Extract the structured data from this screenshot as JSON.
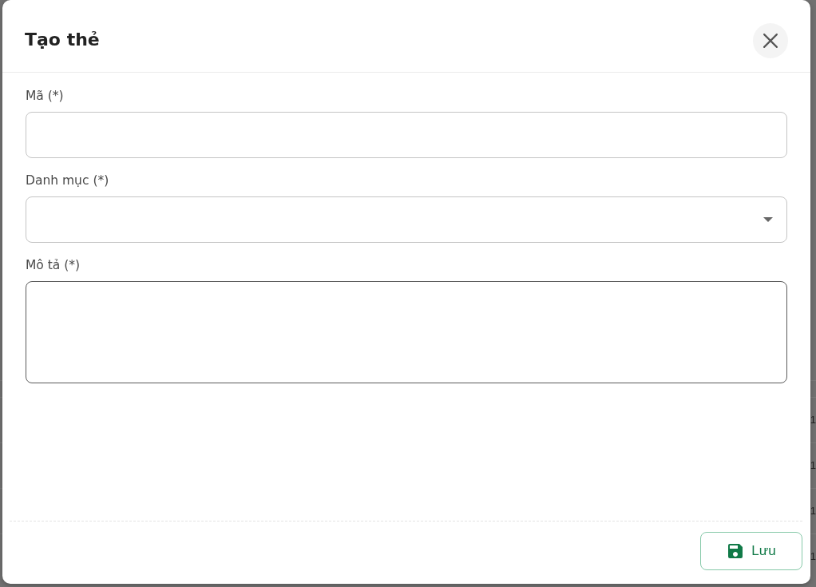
{
  "backdrop": {
    "rows": [
      {
        "column_1": "1"
      },
      {
        "column_1": "1"
      },
      {
        "column_1": "1"
      },
      {
        "column_1": "1"
      }
    ]
  },
  "dialog": {
    "title": "Tạo thẻ",
    "fields": [
      {
        "label": "Mã (*)",
        "kind": "text",
        "focused": false
      },
      {
        "label": "Danh mục (*)",
        "kind": "select",
        "focused": false
      },
      {
        "label": "Mô tả (*)",
        "kind": "textarea",
        "focused": true
      }
    ],
    "save_button": {
      "label": "Lưu"
    }
  }
}
